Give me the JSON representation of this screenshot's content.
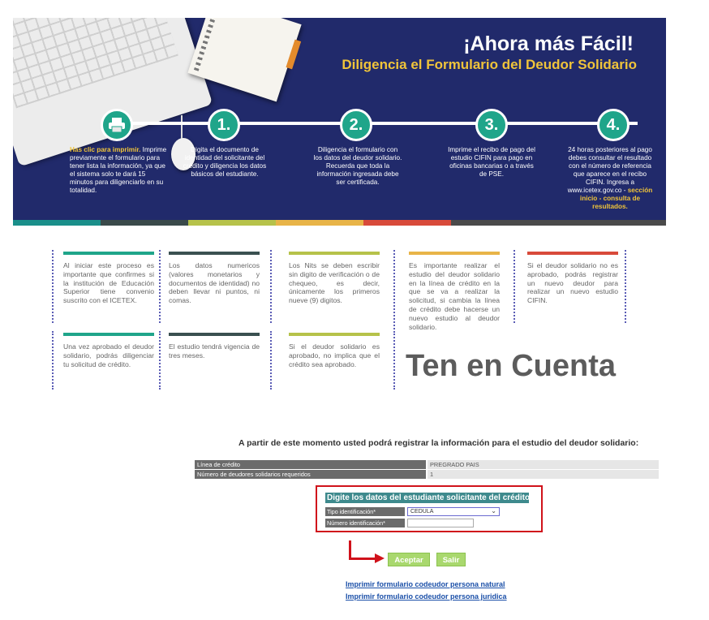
{
  "banner": {
    "title": "¡Ahora más Fácil!",
    "subtitle": "Diligencia el  Formulario del Deudor Solidario",
    "steps": [
      {
        "icon": "printer-icon",
        "number": "",
        "text_highlight": "Has clic para imprimir.",
        "text": "Imprime previamente el formulario para tener lista la información, ya que el sistema solo te dará 15 minutos para diligenciarlo en su totalidad.",
        "text_tail": ""
      },
      {
        "number": "1.",
        "text_highlight": "",
        "text": "Digita el documento de identidad del solicitante del crédito y diligencia los datos básicos del estudiante.",
        "text_tail": ""
      },
      {
        "number": "2.",
        "text_highlight": "",
        "text": "Diligencia el formulario con los datos del deudor solidario. Recuerda que toda la información ingresada debe ser certificada.",
        "text_tail": ""
      },
      {
        "number": "3.",
        "text_highlight": "",
        "text": "Imprime el recibo de pago del estudio CIFIN para pago en oficinas bancarias o a través de PSE.",
        "text_tail": ""
      },
      {
        "number": "4.",
        "text_highlight": "",
        "text": "24 horas posteriores al pago debes consultar el resultado con el número de referencia que aparece en el recibo CIFIN. Ingresa a www.icetex.gov.co - ",
        "text_tail": "sección inicio - consulta de resultados."
      }
    ],
    "colors": {
      "background": "#212a6b",
      "accent": "#1fa58a",
      "highlight": "#f0c43a"
    },
    "bottom_bar_colors": [
      "#1a8f8a",
      "#3a4a4a",
      "#b6c24a",
      "#e8b448",
      "#d84a3a",
      "#4a4a4a"
    ]
  },
  "tips": [
    {
      "color": "#1fa58a",
      "text": "Al iniciar este proceso es importante que confirmes si la institución de Educación Superior tiene convenio suscrito con el ICETEX."
    },
    {
      "color": "#3a5050",
      "text": "Los datos numericos (valores monetarios y documentos de identidad) no deben llevar ni puntos, ni comas."
    },
    {
      "color": "#b6c24a",
      "text": "Los Nits se deben escribir sin digito de verificación o de chequeo, es decir, únicamente los primeros nueve (9) digitos."
    },
    {
      "color": "#e8b448",
      "text": "Es importante realizar el estudio del deudor solidario en la línea de crédito en la que se va a realizar la solicitud, si cambia la línea de crédito debe hacerse un nuevo estudio al deudor solidario."
    },
    {
      "color": "#d84a3a",
      "text": "Si el deudor solidario no es aprobado, podrás registrar un nuevo deudor para realizar un nuevo estudio CIFIN."
    },
    {
      "color": "#1fa58a",
      "text": "Una vez aprobado el deudor solidario, podrás diligenciar tu solicitud de crédito."
    },
    {
      "color": "#3a5050",
      "text": "El estudio tendrá vigencia de tres meses."
    },
    {
      "color": "#b6c24a",
      "text": "Si el deudor solidario es aprobado, no implica que el crédito sea aprobado."
    }
  ],
  "ten_en_cuenta": "Ten en Cuenta",
  "form": {
    "intro": "A partir de este momento usted podrá registrar la información para el estudio del deudor solidario:",
    "rows": [
      {
        "label": "Línea de crédito",
        "value": "PREGRADO PAIS"
      },
      {
        "label": "Número de deudores solidarios requeridos",
        "value": "1"
      }
    ],
    "student_title": "Digite los datos del estudiante solicitante del crédito",
    "tipo_label": "Tipo identificación*",
    "tipo_value": "CEDULA",
    "numero_label": "Número identificación*",
    "numero_value": "",
    "accept_label": "Aceptar",
    "exit_label": "Salir",
    "links": [
      "Imprimir formulario codeudor persona natural",
      "Imprimir formulario codeudor persona juridica"
    ]
  }
}
